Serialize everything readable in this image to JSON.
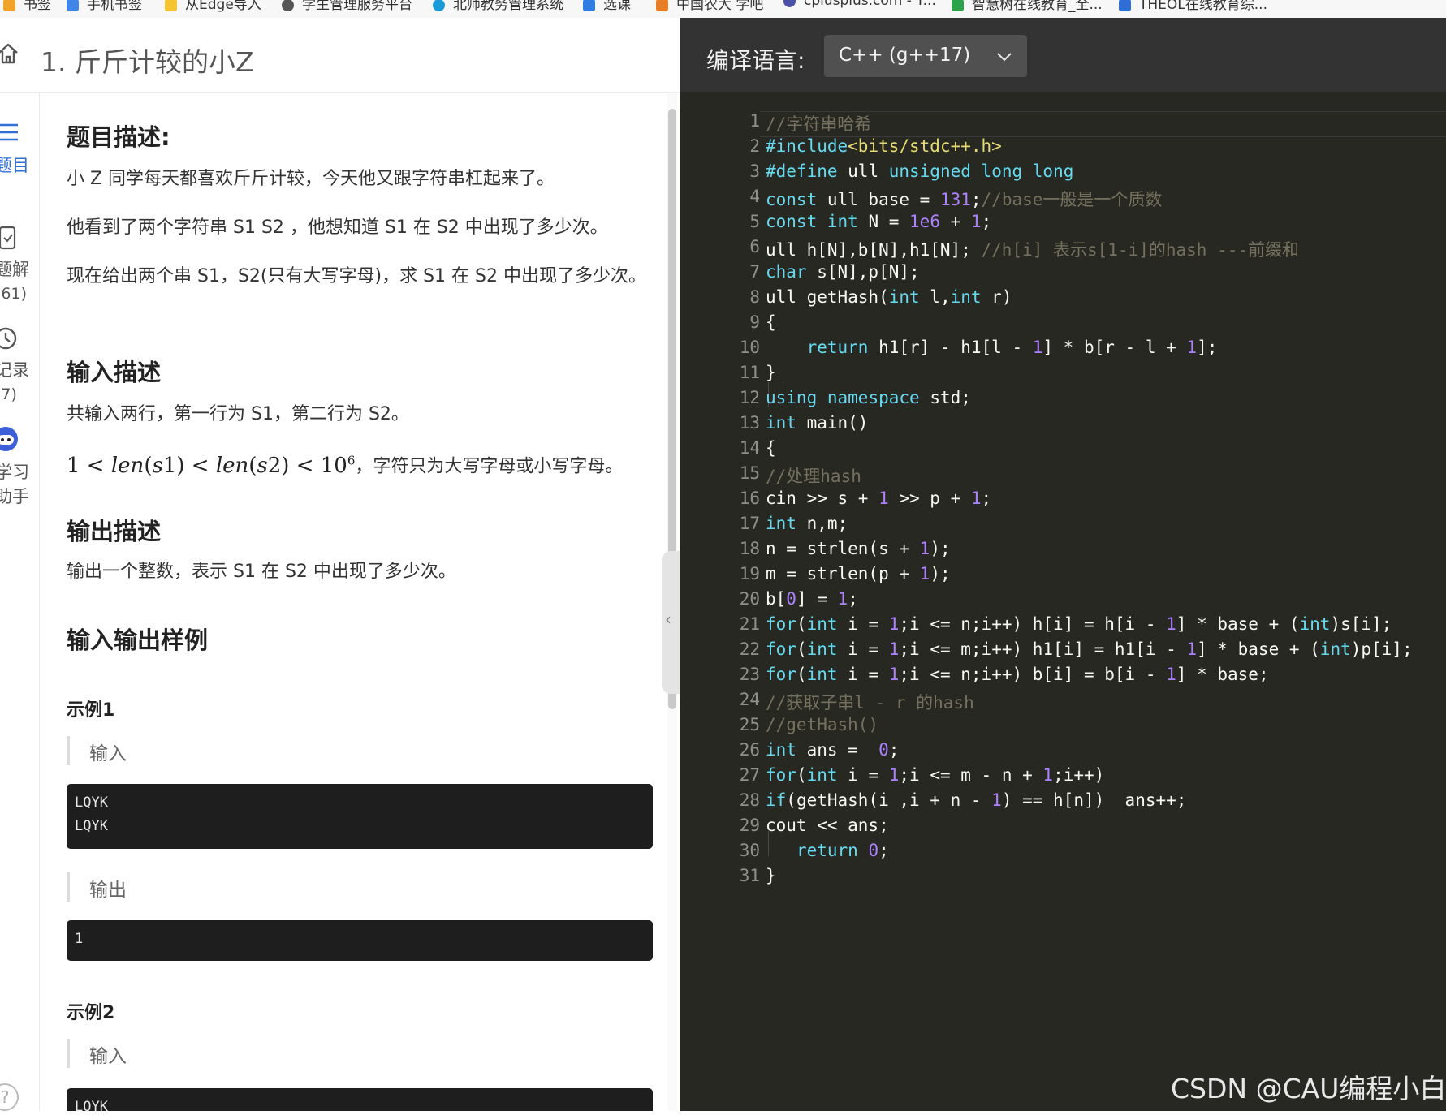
{
  "bookmarks": [
    {
      "label": "书签",
      "color": "#f0a42a"
    },
    {
      "label": "手机书签",
      "color": "#3f86e6"
    },
    {
      "label": "从Edge导入",
      "color": "#f4c431"
    },
    {
      "label": "学生管理服务平台",
      "color": "#555555"
    },
    {
      "label": "北师教务管理系统",
      "color": "#1a9bd7"
    },
    {
      "label": "选课",
      "color": "#2f7de1"
    },
    {
      "label": "中国农大 学吧",
      "color": "#e87d25"
    },
    {
      "label": "cplusplus.com - T...",
      "color": "#4a52a8"
    },
    {
      "label": "智慧树在线教育_全...",
      "color": "#2ca24a"
    },
    {
      "label": "THEOL在线教育综...",
      "color": "#2e6ed6"
    }
  ],
  "problem": {
    "title": "1. 斤斤计较的小Z",
    "description_heading": "题目描述:",
    "description_paragraphs": [
      "小 Z 同学每天都喜欢斤斤计较，今天他又跟字符串杠起来了。",
      "他看到了两个字符串 S1 S2 ，他想知道 S1 在 S2 中出现了多少次。",
      "现在给出两个串 S1，S2(只有大写字母)，求 S1 在 S2 中出现了多少次。"
    ],
    "input_heading": "输入描述",
    "input_text": "共输入两行，第一行为 S1，第二行为 S2。",
    "constraint_tail": "，字符只为大写字母或小写字母。",
    "output_heading": "输出描述",
    "output_text": "输出一个整数，表示 S1 在 S2 中出现了多少次。",
    "samples_heading": "输入输出样例",
    "sample1_title": "示例1",
    "sample1_input_label": "输入",
    "sample1_input_lines": [
      "LQYK",
      "LQYK"
    ],
    "sample1_output_label": "输出",
    "sample1_output": "1",
    "sample2_title": "示例2",
    "sample2_input_label": "输入",
    "sample2_input_first": "LQYK"
  },
  "rail": {
    "problem_label": "题目",
    "solutions_label": "题解",
    "solutions_count": "(61)",
    "records_label": "记录",
    "records_count": "(7)",
    "assistant_label_1": "学习",
    "assistant_label_2": "助手"
  },
  "editor": {
    "language_label": "编译语言:",
    "language_value": "C++ (g++17)",
    "line_count": 31
  },
  "watermark": "CSDN @CAU编程小白",
  "colors": {
    "accent_blue": "#2f6fd6",
    "editor_bg": "#272822",
    "editor_header_bg": "#333333"
  }
}
